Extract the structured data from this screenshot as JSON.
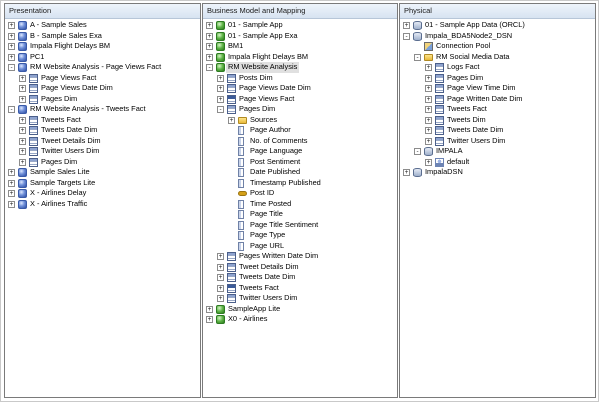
{
  "panels": {
    "presentation": {
      "title": "Presentation",
      "items": [
        {
          "label": "A - Sample Sales",
          "level": 0,
          "toggle": "+",
          "icon": "subject-area-cube-icon"
        },
        {
          "label": "B - Sample Sales Exa",
          "level": 0,
          "toggle": "+",
          "icon": "subject-area-cube-icon"
        },
        {
          "label": "Impala Flight Delays BM",
          "level": 0,
          "toggle": "+",
          "icon": "subject-area-cube-icon"
        },
        {
          "label": "PC1",
          "level": 0,
          "toggle": "+",
          "icon": "subject-area-cube-icon"
        },
        {
          "label": "RM Website Analysis - Page Views Fact",
          "level": 0,
          "toggle": "-",
          "icon": "subject-area-cube-icon"
        },
        {
          "label": "Page Views Fact",
          "level": 1,
          "toggle": "+",
          "icon": "presentation-table-icon"
        },
        {
          "label": "Page Views Date Dim",
          "level": 1,
          "toggle": "+",
          "icon": "presentation-table-icon"
        },
        {
          "label": "Pages Dim",
          "level": 1,
          "toggle": "+",
          "icon": "presentation-table-icon"
        },
        {
          "label": "RM Website Analysis - Tweets Fact",
          "level": 0,
          "toggle": "-",
          "icon": "subject-area-cube-icon"
        },
        {
          "label": "Tweets Fact",
          "level": 1,
          "toggle": "+",
          "icon": "presentation-table-icon"
        },
        {
          "label": "Tweets Date Dim",
          "level": 1,
          "toggle": "+",
          "icon": "presentation-table-icon"
        },
        {
          "label": "Tweet Details Dim",
          "level": 1,
          "toggle": "+",
          "icon": "presentation-table-icon"
        },
        {
          "label": "Twitter Users Dim",
          "level": 1,
          "toggle": "+",
          "icon": "presentation-table-icon"
        },
        {
          "label": "Pages Dim",
          "level": 1,
          "toggle": "+",
          "icon": "presentation-table-icon"
        },
        {
          "label": "Sample Sales Lite",
          "level": 0,
          "toggle": "+",
          "icon": "subject-area-cube-icon"
        },
        {
          "label": "Sample Targets Lite",
          "level": 0,
          "toggle": "+",
          "icon": "subject-area-cube-icon"
        },
        {
          "label": "X - Airlines Delay",
          "level": 0,
          "toggle": "+",
          "icon": "subject-area-cube-icon"
        },
        {
          "label": "X - Airlines Traffic",
          "level": 0,
          "toggle": "+",
          "icon": "subject-area-cube-icon"
        }
      ]
    },
    "bmm": {
      "title": "Business Model and Mapping",
      "items": [
        {
          "label": "01 - Sample App",
          "level": 0,
          "toggle": "+",
          "icon": "business-model-icon"
        },
        {
          "label": "01 - Sample App Exa",
          "level": 0,
          "toggle": "+",
          "icon": "business-model-icon"
        },
        {
          "label": "BM1",
          "level": 0,
          "toggle": "+",
          "icon": "business-model-icon"
        },
        {
          "label": "Impala Flight Delays BM",
          "level": 0,
          "toggle": "+",
          "icon": "business-model-icon"
        },
        {
          "label": "RM Website Analysis",
          "level": 0,
          "toggle": "-",
          "icon": "business-model-icon",
          "selected": true
        },
        {
          "label": "Posts Dim",
          "level": 1,
          "toggle": "+",
          "icon": "logical-table-icon"
        },
        {
          "label": "Page Views Date Dim",
          "level": 1,
          "toggle": "+",
          "icon": "logical-table-icon"
        },
        {
          "label": "Page Views Fact",
          "level": 1,
          "toggle": "+",
          "icon": "fact-table-icon"
        },
        {
          "label": "Pages Dim",
          "level": 1,
          "toggle": "-",
          "icon": "logical-table-icon"
        },
        {
          "label": "Sources",
          "level": 2,
          "toggle": "+",
          "icon": "folder-icon"
        },
        {
          "label": "Page Author",
          "level": 2,
          "toggle": "",
          "icon": "column-icon"
        },
        {
          "label": "No. of Comments",
          "level": 2,
          "toggle": "",
          "icon": "column-icon"
        },
        {
          "label": "Page Language",
          "level": 2,
          "toggle": "",
          "icon": "column-icon"
        },
        {
          "label": "Post Sentiment",
          "level": 2,
          "toggle": "",
          "icon": "column-icon"
        },
        {
          "label": "Date Published",
          "level": 2,
          "toggle": "",
          "icon": "column-icon"
        },
        {
          "label": "Timestamp Published",
          "level": 2,
          "toggle": "",
          "icon": "column-icon"
        },
        {
          "label": "Post ID",
          "level": 2,
          "toggle": "",
          "icon": "key-icon"
        },
        {
          "label": "Time Posted",
          "level": 2,
          "toggle": "",
          "icon": "column-icon"
        },
        {
          "label": "Page Title",
          "level": 2,
          "toggle": "",
          "icon": "column-icon"
        },
        {
          "label": "Page Title Sentiment",
          "level": 2,
          "toggle": "",
          "icon": "column-icon"
        },
        {
          "label": "Page Type",
          "level": 2,
          "toggle": "",
          "icon": "column-icon"
        },
        {
          "label": "Page URL",
          "level": 2,
          "toggle": "",
          "icon": "column-icon"
        },
        {
          "label": "Pages Written Date Dim",
          "level": 1,
          "toggle": "+",
          "icon": "logical-table-icon"
        },
        {
          "label": "Tweet Details Dim",
          "level": 1,
          "toggle": "+",
          "icon": "logical-table-icon"
        },
        {
          "label": "Tweets Date Dim",
          "level": 1,
          "toggle": "+",
          "icon": "logical-table-icon"
        },
        {
          "label": "Tweets Fact",
          "level": 1,
          "toggle": "+",
          "icon": "fact-table-icon"
        },
        {
          "label": "Twitter Users Dim",
          "level": 1,
          "toggle": "+",
          "icon": "logical-table-icon"
        },
        {
          "label": "SampleApp Lite",
          "level": 0,
          "toggle": "+",
          "icon": "business-model-icon"
        },
        {
          "label": "X0 - Airlines",
          "level": 0,
          "toggle": "+",
          "icon": "business-model-icon"
        }
      ]
    },
    "physical": {
      "title": "Physical",
      "items": [
        {
          "label": "01 - Sample App Data (ORCL)",
          "level": 0,
          "toggle": "+",
          "icon": "database-icon"
        },
        {
          "label": "Impala_BDA5Node2_DSN",
          "level": 0,
          "toggle": "-",
          "icon": "database-icon"
        },
        {
          "label": "Connection Pool",
          "level": 1,
          "toggle": "",
          "icon": "connection-pool-icon"
        },
        {
          "label": "RM Social Media Data",
          "level": 1,
          "toggle": "-",
          "icon": "folder-icon"
        },
        {
          "label": "Logs Fact",
          "level": 2,
          "toggle": "+",
          "icon": "physical-table-icon"
        },
        {
          "label": "Pages Dim",
          "level": 2,
          "toggle": "+",
          "icon": "physical-table-icon"
        },
        {
          "label": "Page View Time Dim",
          "level": 2,
          "toggle": "+",
          "icon": "physical-table-icon"
        },
        {
          "label": "Page Written Date Dim",
          "level": 2,
          "toggle": "+",
          "icon": "physical-table-icon"
        },
        {
          "label": "Tweets Fact",
          "level": 2,
          "toggle": "+",
          "icon": "physical-table-icon"
        },
        {
          "label": "Tweets Dim",
          "level": 2,
          "toggle": "+",
          "icon": "physical-table-icon"
        },
        {
          "label": "Tweets Date Dim",
          "level": 2,
          "toggle": "+",
          "icon": "physical-table-icon"
        },
        {
          "label": "Twitter Users Dim",
          "level": 2,
          "toggle": "+",
          "icon": "physical-table-icon"
        },
        {
          "label": "IMPALA",
          "level": 1,
          "toggle": "-",
          "icon": "catalog-icon"
        },
        {
          "label": "default",
          "level": 2,
          "toggle": "+",
          "icon": "schema-icon"
        },
        {
          "label": "ImpalaDSN",
          "level": 0,
          "toggle": "+",
          "icon": "database-icon"
        }
      ]
    }
  }
}
